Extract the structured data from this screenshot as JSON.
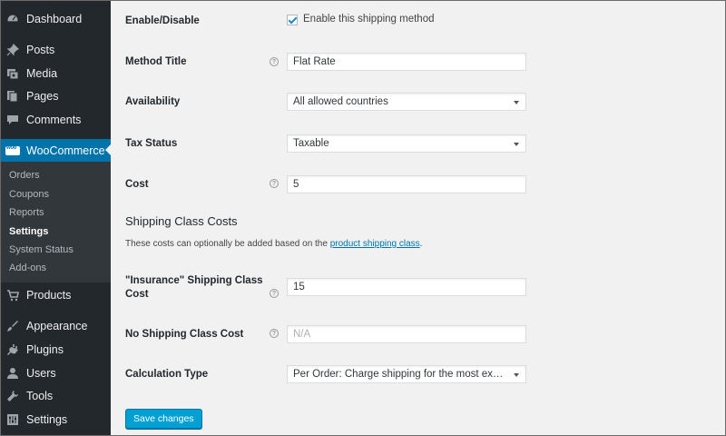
{
  "sidebar": {
    "dashboard": "Dashboard",
    "posts": "Posts",
    "media": "Media",
    "pages": "Pages",
    "comments": "Comments",
    "woocommerce": "WooCommerce",
    "submenu": [
      "Orders",
      "Coupons",
      "Reports",
      "Settings",
      "System Status",
      "Add-ons"
    ],
    "products": "Products",
    "appearance": "Appearance",
    "plugins": "Plugins",
    "users": "Users",
    "tools": "Tools",
    "settings": "Settings"
  },
  "form": {
    "enable_label": "Enable/Disable",
    "enable_checkbox": "Enable this shipping method",
    "method_title_label": "Method Title",
    "method_title_value": "Flat Rate",
    "availability_label": "Availability",
    "availability_value": "All allowed countries",
    "tax_status_label": "Tax Status",
    "tax_status_value": "Taxable",
    "cost_label": "Cost",
    "cost_value": "5",
    "section_title": "Shipping Class Costs",
    "section_desc": "These costs can optionally be added based on the ",
    "section_link": "product shipping class",
    "section_desc_end": ".",
    "insurance_label_1": "\"Insurance\" Shipping Class",
    "insurance_label_2": "Cost",
    "insurance_value": "15",
    "no_class_label": "No Shipping Class Cost",
    "no_class_placeholder": "N/A",
    "calc_type_label": "Calculation Type",
    "calc_type_value": "Per Order: Charge shipping for the most expensive shipping class",
    "save_button": "Save changes",
    "help_glyph": "?"
  },
  "colors": {
    "sidebar_bg": "#23282d",
    "active_bg": "#0073aa",
    "submenu_bg": "#32373c",
    "button_bg": "#00a0d2",
    "content_bg": "#f1f1f1"
  }
}
